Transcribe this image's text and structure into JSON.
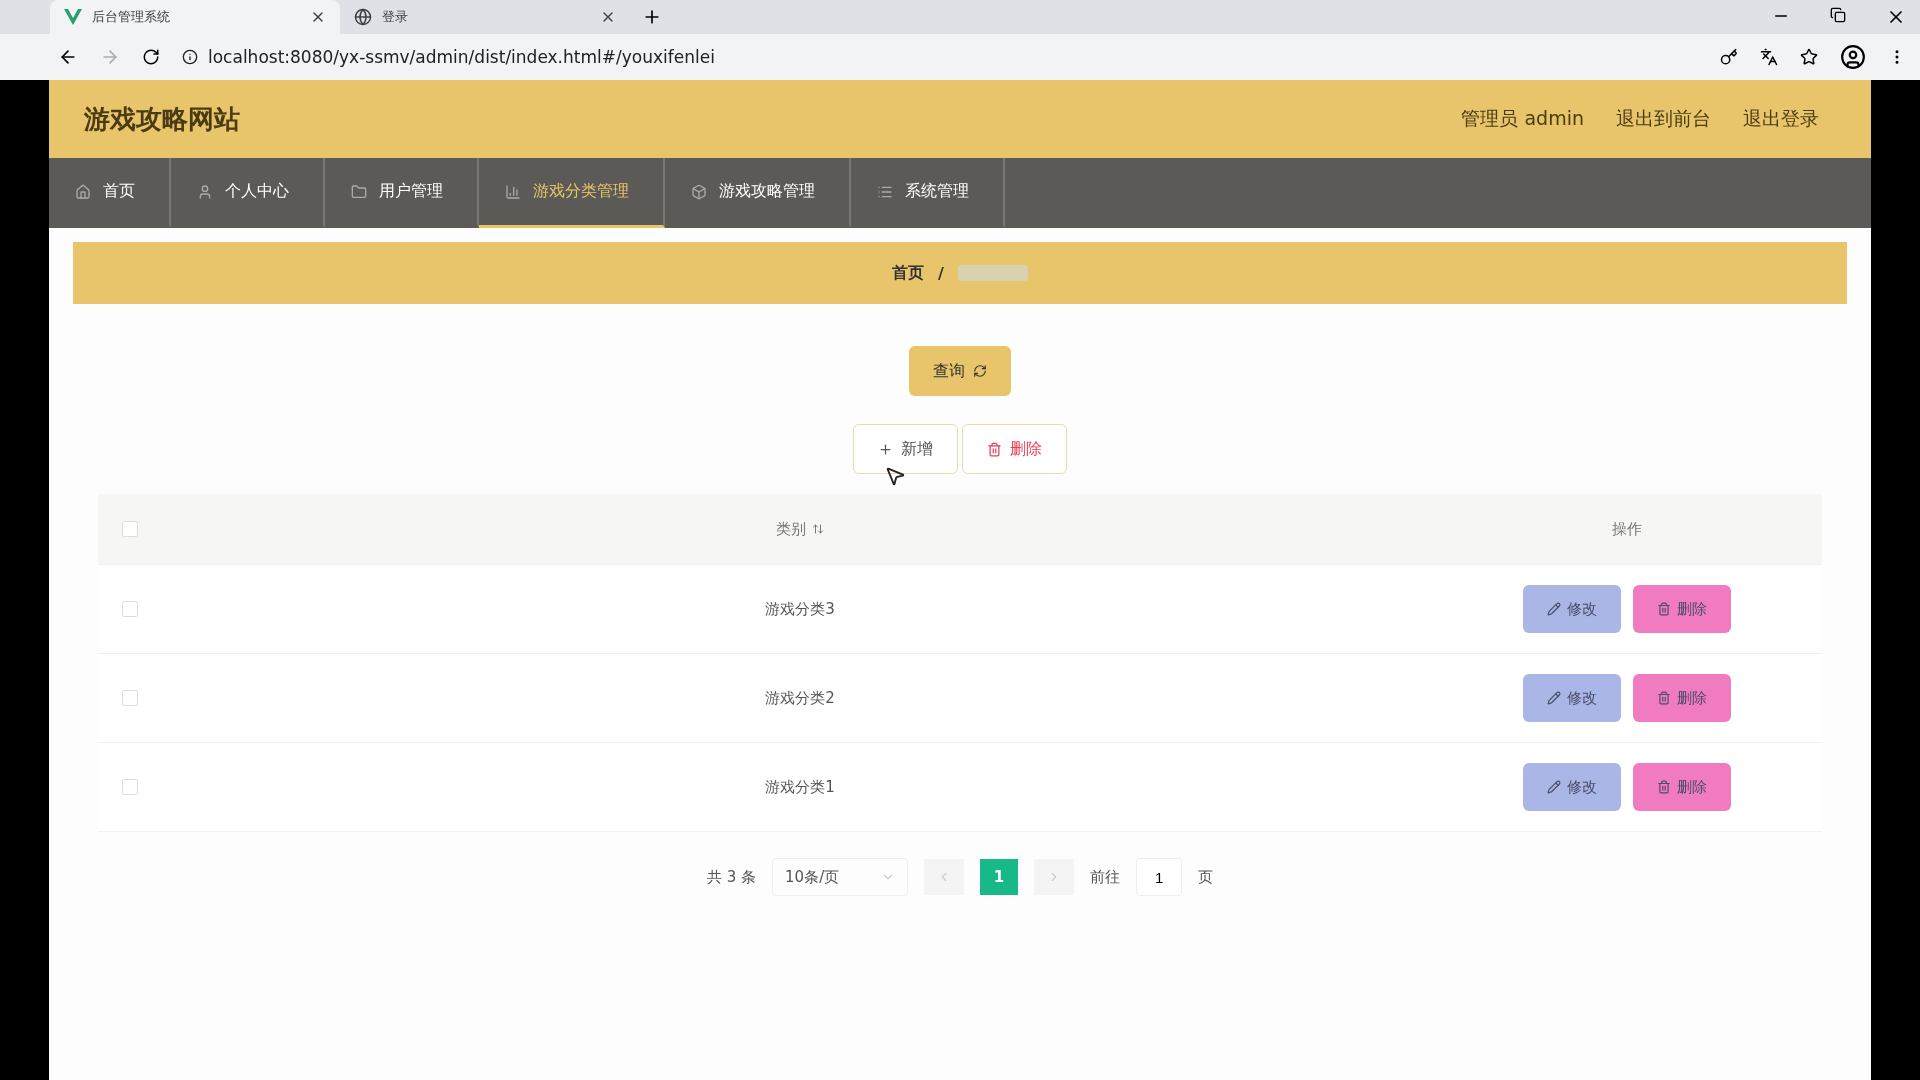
{
  "browser": {
    "tabs": [
      {
        "title": "后台管理系统",
        "selected": true,
        "kind": "app"
      },
      {
        "title": "登录",
        "selected": false,
        "kind": "globe"
      }
    ],
    "url": "localhost:8080/yx-ssmv/admin/dist/index.html#/youxifenlei"
  },
  "header": {
    "site_title": "游戏攻略网站",
    "user_label": "管理员 admin",
    "links": [
      "退出到前台",
      "退出登录"
    ]
  },
  "nav": {
    "items": [
      {
        "label": "首页",
        "selected": false
      },
      {
        "label": "个人中心",
        "selected": false
      },
      {
        "label": "用户管理",
        "selected": false
      },
      {
        "label": "游戏分类管理",
        "selected": true
      },
      {
        "label": "游戏攻略管理",
        "selected": false
      },
      {
        "label": "系统管理",
        "selected": false
      }
    ]
  },
  "breadcrumb": {
    "home": "首页",
    "separator": "/"
  },
  "toolbar": {
    "search_button": "查询",
    "add_button": "新增",
    "delete_button": "删除"
  },
  "table": {
    "columns": [
      "类别",
      "操作"
    ],
    "header_checked": false,
    "rows": [
      {
        "category": "游戏分类3",
        "checked": false,
        "actions": [
          "修改",
          "删除"
        ]
      },
      {
        "category": "游戏分类2",
        "checked": false,
        "actions": [
          "修改",
          "删除"
        ]
      },
      {
        "category": "游戏分类1",
        "checked": false,
        "actions": [
          "修改",
          "删除"
        ]
      }
    ]
  },
  "pagination": {
    "total": "共 3 条",
    "page_size": "10条/页",
    "pages": [
      {
        "label": "1",
        "selected": true
      }
    ],
    "goto_label": "前往",
    "goto_value": "1",
    "page_unit": "页"
  }
}
